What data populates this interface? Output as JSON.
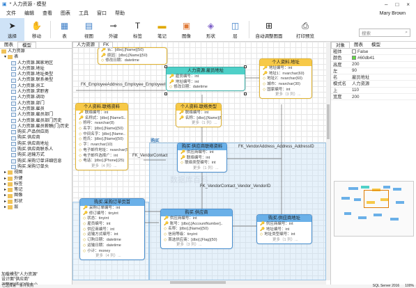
{
  "window": {
    "title": "* 人力资源 - 模型"
  },
  "menu": [
    "文件",
    "编辑",
    "查看",
    "图表",
    "工具",
    "窗口",
    "帮助"
  ],
  "user": "Mary Brown",
  "toolbar": {
    "tools": [
      "选择",
      "移动",
      "表",
      "视图",
      "外键",
      "标签",
      "笔记",
      "图像",
      "形状",
      "层",
      "自动调整图面",
      "打印预览"
    ],
    "search_placeholder": "搜索"
  },
  "left": {
    "tabs": [
      "图表",
      "模型"
    ],
    "tree_root": "人力资源",
    "tree_group": "表",
    "tables": [
      "人力资源.国家地区",
      "人力资源.地址",
      "人力资源.地址类型",
      "人力资源.联系类型",
      "人力资源.员工",
      "人力资源.求职者",
      "人力资源.调动",
      "人力资源.部门",
      "人力资源.雇员",
      "人力资源.雇员部门",
      "人力资源.雇员部门历史",
      "人力资源.雇员薪酬(门)历史",
      "购买.产品供应商",
      "购买.供应商",
      "购买.供应商地址",
      "购买.供应商联系人",
      "购买.运输方式",
      "购买.采购订单详细信息",
      "购买.采购订单头"
    ],
    "groups": [
      "视图",
      "外键",
      "标签",
      "笔记",
      "图像",
      "形状",
      "层"
    ],
    "status": [
      "加载模型\"人力资源\"",
      "设计面\"供应商\"",
      "调整层\"购买\"的大小"
    ]
  },
  "canvas": {
    "tabs": [
      "人力资源",
      "FK"
    ],
    "region_labels": [
      "购买",
      "购买"
    ],
    "labels": [
      "FK_EmployeeAddress_Employee_EmployeeID",
      "FK_VendorContact",
      "FK_VendorAddress_Address_AddressID",
      "FK_VendorContact_Vendor_VendorID"
    ],
    "watermark": "数据库百科",
    "entities": [
      {
        "id": "e1",
        "title": "",
        "rows": [
          "名：[dbo].[Name](50)",
          "原因：[dbo].[Name](50)",
          "修改日期：datetime"
        ],
        "more": ""
      },
      {
        "id": "e2",
        "title": "人力资源.雇员地址",
        "rows": [
          "雇员编号：int",
          "地址编号：int",
          "修改日期：datetime"
        ],
        "more": ""
      },
      {
        "id": "e3",
        "title": "个人资料.地址",
        "rows": [
          "地址编号：int",
          "地址1：nvarchar(60)",
          "地址2：nvarchar(60)",
          "城市：nvarchar(30)",
          "国家编号：int"
        ],
        "more": "更多（3 列）..."
      },
      {
        "id": "e4",
        "title": "个人资料.联络资料",
        "rows": [
          "联络编号：int",
          "名称式：[dbo].[NameS..",
          "称呼：nvarchar(8)",
          "名字：[dbo].[Name](50)",
          "中间名字：[dbo].[Name..",
          "姓氏：[dbo].[Name](50)",
          "字：nvarchar(10)",
          "电子邮件地址：nvarchar(50)",
          "电子邮件选择广：int",
          "电话：[dbo].[Phone](25)"
        ],
        "more": "更多（4 列）..."
      },
      {
        "id": "e5",
        "title": "个人资料.联络类型",
        "rows": [
          "联络编号：int",
          "名称：[dbo].[Name](5..."
        ],
        "more": "更多（1 列）..."
      },
      {
        "id": "e6",
        "title": "购买.供应商联络资料",
        "rows": [
          "供应商编号：int",
          "联络编号：int",
          "联络类型编号：int"
        ],
        "more": "更多（1 列）..."
      },
      {
        "id": "e7",
        "title": "购买.采购订单页首",
        "rows": [
          "采购订单编号：int",
          "修订编号：tinyint",
          "状态：tinyint",
          "雇员编号：int",
          "供应商编号：int",
          "运输方式编号：int",
          "订购日期：datetime",
          "运输日期：datetime",
          "小计：money"
        ],
        "more": "更多（4 列）..."
      },
      {
        "id": "e8",
        "title": "购买.供应商",
        "rows": [
          "供应商编号：int",
          "账号：[dbo].[AccountNumber]..",
          "名称：[dbo].[Name](50)",
          "信用等级：tinyint",
          "首选供应商：[dbo].[Flag](50)"
        ],
        "more": "更多（3 列）..."
      },
      {
        "id": "e9",
        "title": "购买.供应商地址",
        "rows": [
          "供应商编号：int",
          "地址编号：int",
          "地址类型编号：int"
        ],
        "more": "更多（1 列）..."
      }
    ]
  },
  "right": {
    "tabs": [
      "对象",
      "图表",
      "模型"
    ],
    "props": [
      {
        "k": "粗体",
        "v": "False",
        "type": "check"
      },
      {
        "k": "颜色",
        "v": "#60db41",
        "type": "color"
      },
      {
        "k": "高度",
        "v": "200"
      },
      {
        "k": "左",
        "v": "90"
      },
      {
        "k": "名",
        "v": "雇员地址"
      },
      {
        "k": "模式名",
        "v": "人力资源"
      },
      {
        "k": "上",
        "v": "110"
      },
      {
        "k": "宽度",
        "v": "200"
      }
    ]
  },
  "statusbar": {
    "left": "已选择第一条件实例",
    "db": "SQL Server 2016",
    "zoom": "100%"
  },
  "colors": {
    "yellow": "#f7c948",
    "blue": "#6ab0e8",
    "teal": "#4fd0c8",
    "accent": "#60db41"
  }
}
